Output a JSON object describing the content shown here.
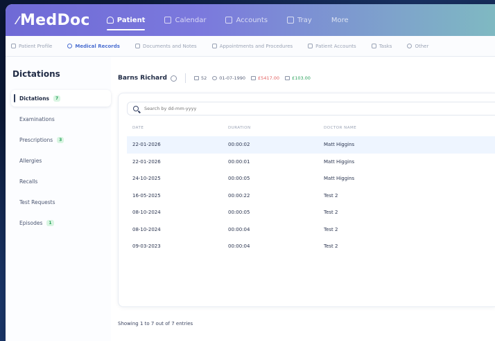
{
  "app": {
    "logo": "MedDoc"
  },
  "nav": {
    "items": [
      {
        "label": "Patient",
        "active": true
      },
      {
        "label": "Calendar",
        "active": false
      },
      {
        "label": "Accounts",
        "active": false
      },
      {
        "label": "Tray",
        "active": false
      },
      {
        "label": "More",
        "active": false
      }
    ]
  },
  "subnav": {
    "items": [
      {
        "label": "Patient Profile",
        "active": false
      },
      {
        "label": "Medical Records",
        "active": true
      },
      {
        "label": "Documents and Notes",
        "active": false
      },
      {
        "label": "Appointments and Procedures",
        "active": false
      },
      {
        "label": "Patient Accounts",
        "active": false
      },
      {
        "label": "Tasks",
        "active": false
      },
      {
        "label": "Other",
        "active": false
      }
    ]
  },
  "sidebar": {
    "title": "Dictations",
    "items": [
      {
        "label": "Dictations",
        "badge": "7",
        "active": true
      },
      {
        "label": "Examinations",
        "badge": "",
        "active": false
      },
      {
        "label": "Prescriptions",
        "badge": "3",
        "active": false
      },
      {
        "label": "Allergies",
        "badge": "",
        "active": false
      },
      {
        "label": "Recalls",
        "badge": "",
        "active": false
      },
      {
        "label": "Test Requests",
        "badge": "",
        "active": false
      },
      {
        "label": "Episodes",
        "badge": "1",
        "active": false
      }
    ]
  },
  "patient": {
    "name": "Barns Richard",
    "id": "52",
    "dob": "01-07-1990",
    "balance": "£5417.00",
    "credit": "£103.00"
  },
  "search": {
    "placeholder": "Search by dd-mm-yyyy"
  },
  "table": {
    "headers": [
      "DATE",
      "DURATION",
      "DOCTOR NAME"
    ],
    "rows": [
      {
        "date": "22-01-2026",
        "duration": "00:00:02",
        "doctor": "Matt Higgins"
      },
      {
        "date": "22-01-2026",
        "duration": "00:00:01",
        "doctor": "Matt Higgins"
      },
      {
        "date": "24-10-2025",
        "duration": "00:00:05",
        "doctor": "Matt Higgins"
      },
      {
        "date": "16-05-2025",
        "duration": "00:00:22",
        "doctor": "Test 2"
      },
      {
        "date": "08-10-2024",
        "duration": "00:00:05",
        "doctor": "Test 2"
      },
      {
        "date": "08-10-2024",
        "duration": "00:00:04",
        "doctor": "Test 2"
      },
      {
        "date": "09-03-2023",
        "duration": "00:00:04",
        "doctor": "Test 2"
      }
    ]
  },
  "footer": {
    "entries": "Showing 1 to 7 out of 7 entries"
  }
}
